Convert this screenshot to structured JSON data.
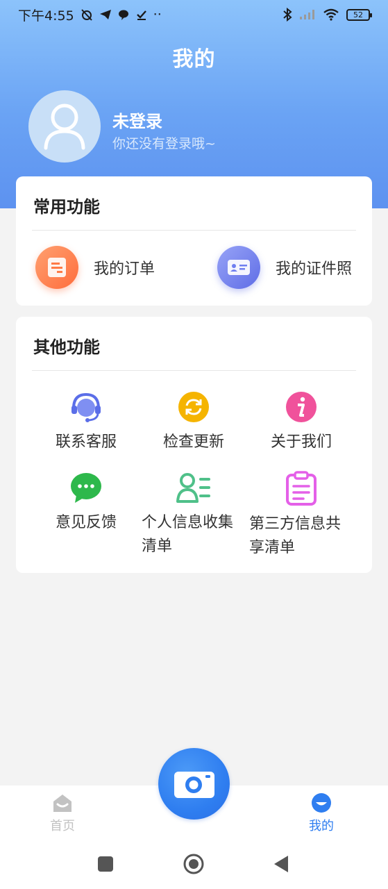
{
  "status_bar": {
    "time": "下午4:55",
    "dots": "··",
    "battery": "52"
  },
  "header": {
    "title": "我的"
  },
  "user": {
    "name": "未登录",
    "subtitle": "你还没有登录哦~"
  },
  "common_functions": {
    "title": "常用功能",
    "items": [
      {
        "label": "我的订单",
        "icon": "order-icon",
        "color": "#ff7a45"
      },
      {
        "label": "我的证件照",
        "icon": "id-card-icon",
        "color": "#6f7ff0"
      }
    ]
  },
  "other_functions": {
    "title": "其他功能",
    "items": [
      {
        "label": "联系客服",
        "icon": "customer-service-icon",
        "color": "#5b6ee8"
      },
      {
        "label": "检查更新",
        "icon": "refresh-icon",
        "color": "#f5b400"
      },
      {
        "label": "关于我们",
        "icon": "info-icon",
        "color": "#f0529b"
      },
      {
        "label": "意见反馈",
        "icon": "chat-bubble-icon",
        "color": "#2db84b"
      },
      {
        "label": "个人信息收集清单",
        "icon": "user-list-icon",
        "color": "#4fc089"
      },
      {
        "label": "第三方信息共享清单",
        "icon": "clipboard-icon",
        "color": "#e460e8"
      }
    ]
  },
  "bottom_nav": {
    "home_label": "首页",
    "mine_label": "我的",
    "active_color": "#2f7ef0",
    "inactive_color": "#c2c2c2"
  }
}
